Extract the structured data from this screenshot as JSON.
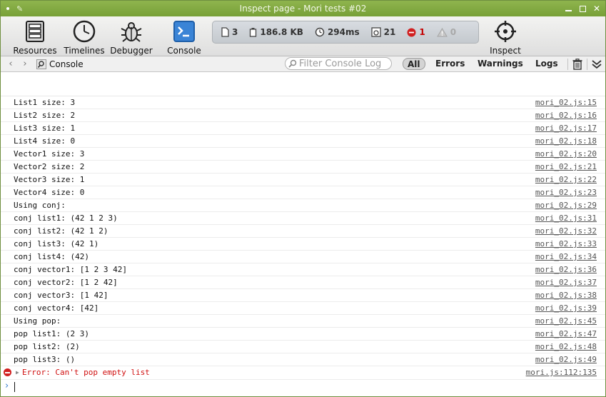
{
  "window": {
    "title": "Inspect page - Mori tests #02"
  },
  "toolbar": {
    "resources_label": "Resources",
    "timelines_label": "Timelines",
    "debugger_label": "Debugger",
    "console_label": "Console",
    "inspect_label": "Inspect",
    "dashboard": {
      "resource_count": "3",
      "resource_size": "186.8 KB",
      "load_time": "294ms",
      "log_count": "21",
      "error_count": "1",
      "warning_count": "0"
    }
  },
  "navbar": {
    "breadcrumb": "Console",
    "filter_placeholder": "Filter Console Log",
    "scope_all": "All",
    "scope_errors": "Errors",
    "scope_warnings": "Warnings",
    "scope_logs": "Logs"
  },
  "console": {
    "messages": [
      {
        "text": "List1 size: 3",
        "source": "mori_02.js:15"
      },
      {
        "text": "List2 size: 2",
        "source": "mori_02.js:16"
      },
      {
        "text": "List3 size: 1",
        "source": "mori_02.js:17"
      },
      {
        "text": "List4 size: 0",
        "source": "mori_02.js:18"
      },
      {
        "text": "Vector1 size: 3",
        "source": "mori_02.js:20"
      },
      {
        "text": "Vector2 size: 2",
        "source": "mori_02.js:21"
      },
      {
        "text": "Vector3 size: 1",
        "source": "mori_02.js:22"
      },
      {
        "text": "Vector4 size: 0",
        "source": "mori_02.js:23"
      },
      {
        "text": "Using conj:",
        "source": "mori_02.js:29"
      },
      {
        "text": "conj list1: (42 1 2 3)",
        "source": "mori_02.js:31"
      },
      {
        "text": "conj list2: (42 1 2)",
        "source": "mori_02.js:32"
      },
      {
        "text": "conj list3: (42 1)",
        "source": "mori_02.js:33"
      },
      {
        "text": "conj list4: (42)",
        "source": "mori_02.js:34"
      },
      {
        "text": "conj vector1: [1 2 3 42]",
        "source": "mori_02.js:36"
      },
      {
        "text": "conj vector2: [1 2 42]",
        "source": "mori_02.js:37"
      },
      {
        "text": "conj vector3: [1 42]",
        "source": "mori_02.js:38"
      },
      {
        "text": "conj vector4: [42]",
        "source": "mori_02.js:39"
      },
      {
        "text": "Using pop:",
        "source": "mori_02.js:45"
      },
      {
        "text": "pop list1: (2 3)",
        "source": "mori_02.js:47"
      },
      {
        "text": "pop list2: (2)",
        "source": "mori_02.js:48"
      },
      {
        "text": "pop list3: ()",
        "source": "mori_02.js:49"
      }
    ],
    "error": {
      "text": "Error: Can't pop empty list",
      "source": "mori.js:112:135"
    }
  },
  "colors": {
    "titlebar": "#7fa83f",
    "accent": "#3a7ed0",
    "error": "#d01010"
  }
}
